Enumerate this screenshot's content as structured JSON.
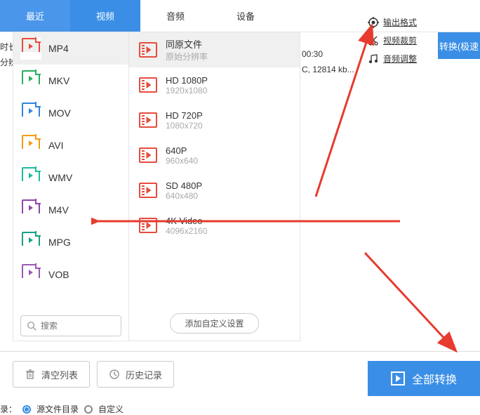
{
  "tabs": {
    "recent": "最近",
    "video": "视频",
    "audio": "音频",
    "device": "设备"
  },
  "links": {
    "output_format": "输出格式",
    "video_crop": "视频裁剪",
    "audio_adjust": "音频调整"
  },
  "convert_small": "转换(极速",
  "side": {
    "duration_label": "时长",
    "resolution_label": "分辨"
  },
  "info": {
    "duration": "00:30",
    "codec": "C, 12814 kb..."
  },
  "formats": [
    {
      "name": "MP4",
      "color": "#e74c3c"
    },
    {
      "name": "MKV",
      "color": "#27ae60"
    },
    {
      "name": "MOV",
      "color": "#2e86de"
    },
    {
      "name": "AVI",
      "color": "#f39c12"
    },
    {
      "name": "WMV",
      "color": "#1abc9c"
    },
    {
      "name": "M4V",
      "color": "#8e44ad"
    },
    {
      "name": "MPG",
      "color": "#16a085"
    },
    {
      "name": "VOB",
      "color": "#9b59b6"
    }
  ],
  "presets": [
    {
      "title": "同原文件",
      "sub": "原始分辨率"
    },
    {
      "title": "HD 1080P",
      "sub": "1920x1080"
    },
    {
      "title": "HD 720P",
      "sub": "1080x720"
    },
    {
      "title": "640P",
      "sub": "960x640"
    },
    {
      "title": "SD 480P",
      "sub": "640x480"
    },
    {
      "title": "4K Video",
      "sub": "4096x2160"
    }
  ],
  "search_placeholder": "搜索",
  "add_custom": "添加自定义设置",
  "bottom": {
    "clear": "清空列表",
    "history": "历史记录",
    "all_convert": "全部转换"
  },
  "save": {
    "label": "录：",
    "opt1": "源文件目录",
    "opt2": "自定义"
  }
}
